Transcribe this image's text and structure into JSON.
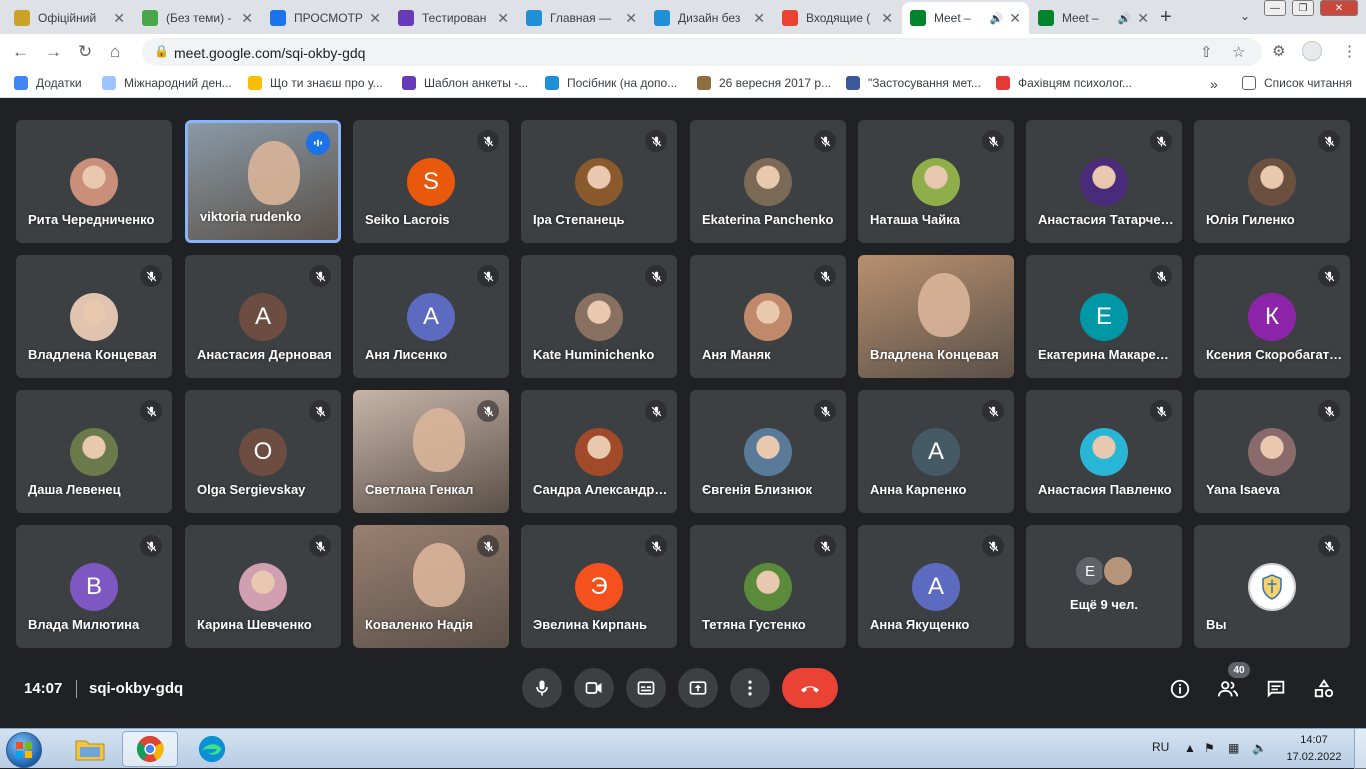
{
  "browser": {
    "tabs": [
      {
        "title": "Офіційний",
        "icon": "shield-crest-icon",
        "color": "#c9a227"
      },
      {
        "title": "(Без теми) -",
        "icon": "mail-icon",
        "color": "#4aa64a"
      },
      {
        "title": "ПРОСМОТР",
        "icon": "document-icon",
        "color": "#1a73e8"
      },
      {
        "title": "Тестирован",
        "icon": "forms-icon",
        "color": "#673ab7"
      },
      {
        "title": "Главная —",
        "icon": "canva-icon",
        "color": "#1f8fd6"
      },
      {
        "title": "Дизайн без",
        "icon": "canva-icon",
        "color": "#1f8fd6"
      },
      {
        "title": "Входящие (",
        "icon": "gmail-icon",
        "color": "#ea4335"
      },
      {
        "title": "Meet –",
        "icon": "meet-icon",
        "color": "#00832d",
        "active": true,
        "audio": true
      },
      {
        "title": "Meet –",
        "icon": "meet-icon",
        "color": "#00832d",
        "audio": true
      }
    ],
    "url": "meet.google.com/sqi-okby-gdq",
    "bookmarks": [
      {
        "label": "Додатки",
        "color": "#4285f4"
      },
      {
        "label": "Міжнародний ден...",
        "color": "#a0c4ff"
      },
      {
        "label": "Що ти знаєш про у...",
        "color": "#fbbc04"
      },
      {
        "label": "Шаблон анкеты -...",
        "color": "#673ab7"
      },
      {
        "label": "Посібник (на допо...",
        "color": "#1f8fd6"
      },
      {
        "label": "26 вересня 2017 р...",
        "color": "#8d6e3f"
      },
      {
        "label": "\"Застосування мет...",
        "color": "#3b5998"
      },
      {
        "label": "Фахівцям психолог...",
        "color": "#e53935"
      }
    ],
    "reading_list": "Список читання",
    "overflow": "»"
  },
  "meet": {
    "participants": [
      {
        "name": "Рита Чередниченко",
        "type": "photo",
        "color": "#c98f7a",
        "muted": false
      },
      {
        "name": "viktoria rudenko",
        "type": "video",
        "color": "#8a9aa6",
        "speaking": true
      },
      {
        "name": "Seiko Lacrois",
        "type": "letter",
        "letter": "S",
        "color": "#e8590c",
        "muted": true
      },
      {
        "name": "Іра Степанець",
        "type": "photo",
        "color": "#8a5a2c",
        "muted": true
      },
      {
        "name": "Ekaterina Panchenko",
        "type": "photo",
        "color": "#7b6a55",
        "muted": true
      },
      {
        "name": "Наташа Чайка",
        "type": "photo",
        "color": "#8fae4a",
        "muted": true
      },
      {
        "name": "Анастасия Татарченко",
        "type": "photo",
        "color": "#4a2a7a",
        "muted": true
      },
      {
        "name": "Юлія Гиленко",
        "type": "photo",
        "color": "#6b5040",
        "muted": true
      },
      {
        "name": "Владлена Концевая",
        "type": "photo",
        "color": "#e0c4b0",
        "muted": true
      },
      {
        "name": "Анастасия Дерновая",
        "type": "letter",
        "letter": "А",
        "color": "#6d4c41",
        "muted": true
      },
      {
        "name": "Аня Лисенко",
        "type": "letter",
        "letter": "А",
        "color": "#5c6bc0",
        "muted": true
      },
      {
        "name": "Kate Huminichenko",
        "type": "photo",
        "color": "#8a7060",
        "muted": true
      },
      {
        "name": "Аня Маняк",
        "type": "photo",
        "color": "#c08a6a",
        "muted": true
      },
      {
        "name": "Владлена Концевая",
        "type": "video",
        "color": "#b89070",
        "muted": false
      },
      {
        "name": "Екатерина Макаренко",
        "type": "letter",
        "letter": "Е",
        "color": "#0097a7",
        "muted": true
      },
      {
        "name": "Ксения Скоробагатько",
        "type": "letter",
        "letter": "К",
        "color": "#8e24aa",
        "muted": true
      },
      {
        "name": "Даша Левенец",
        "type": "photo",
        "color": "#6a7a4a",
        "muted": true
      },
      {
        "name": "Olga Sergievskay",
        "type": "letter",
        "letter": "O",
        "color": "#6d4c41",
        "muted": true
      },
      {
        "name": "Светлана Генкал",
        "type": "video",
        "color": "#c8b4a8",
        "muted": true
      },
      {
        "name": "Сандра Александрова",
        "type": "photo",
        "color": "#a04a2a",
        "muted": true
      },
      {
        "name": "Євгенія Близнюк",
        "type": "photo",
        "color": "#5a7a9a",
        "muted": true
      },
      {
        "name": "Анна Карпенко",
        "type": "letter",
        "letter": "А",
        "color": "#455a64",
        "muted": true
      },
      {
        "name": "Анастасия Павленко",
        "type": "photo",
        "color": "#29b6d6",
        "muted": true
      },
      {
        "name": "Yana Isaeva",
        "type": "photo",
        "color": "#8a6a6a",
        "muted": true
      },
      {
        "name": "Влада Милютина",
        "type": "letter",
        "letter": "В",
        "color": "#7e57c2",
        "muted": true
      },
      {
        "name": "Карина Шевченко",
        "type": "photo",
        "color": "#d0a0b0",
        "muted": true
      },
      {
        "name": "Коваленко Надія",
        "type": "video",
        "color": "#9a8070",
        "muted": true
      },
      {
        "name": "Эвелина Кирпань",
        "type": "letter",
        "letter": "Э",
        "color": "#f4511e",
        "muted": true
      },
      {
        "name": "Тетяна Густенко",
        "type": "photo",
        "color": "#5a8a3a",
        "muted": true
      },
      {
        "name": "Анна Якущенко",
        "type": "letter",
        "letter": "А",
        "color": "#5c6bc0",
        "muted": true
      },
      {
        "name": "Ещё 9 чел.",
        "type": "more",
        "letter": "E"
      },
      {
        "name": "Вы",
        "type": "photo",
        "color": "#ffffff",
        "muted": true,
        "self": true
      }
    ],
    "clock": "14:07",
    "meeting_code": "sqi-okby-gdq",
    "participant_count": "40",
    "hangup_color": "#ea4335"
  },
  "taskbar": {
    "lang": "RU",
    "time": "14:07",
    "date": "17.02.2022"
  }
}
